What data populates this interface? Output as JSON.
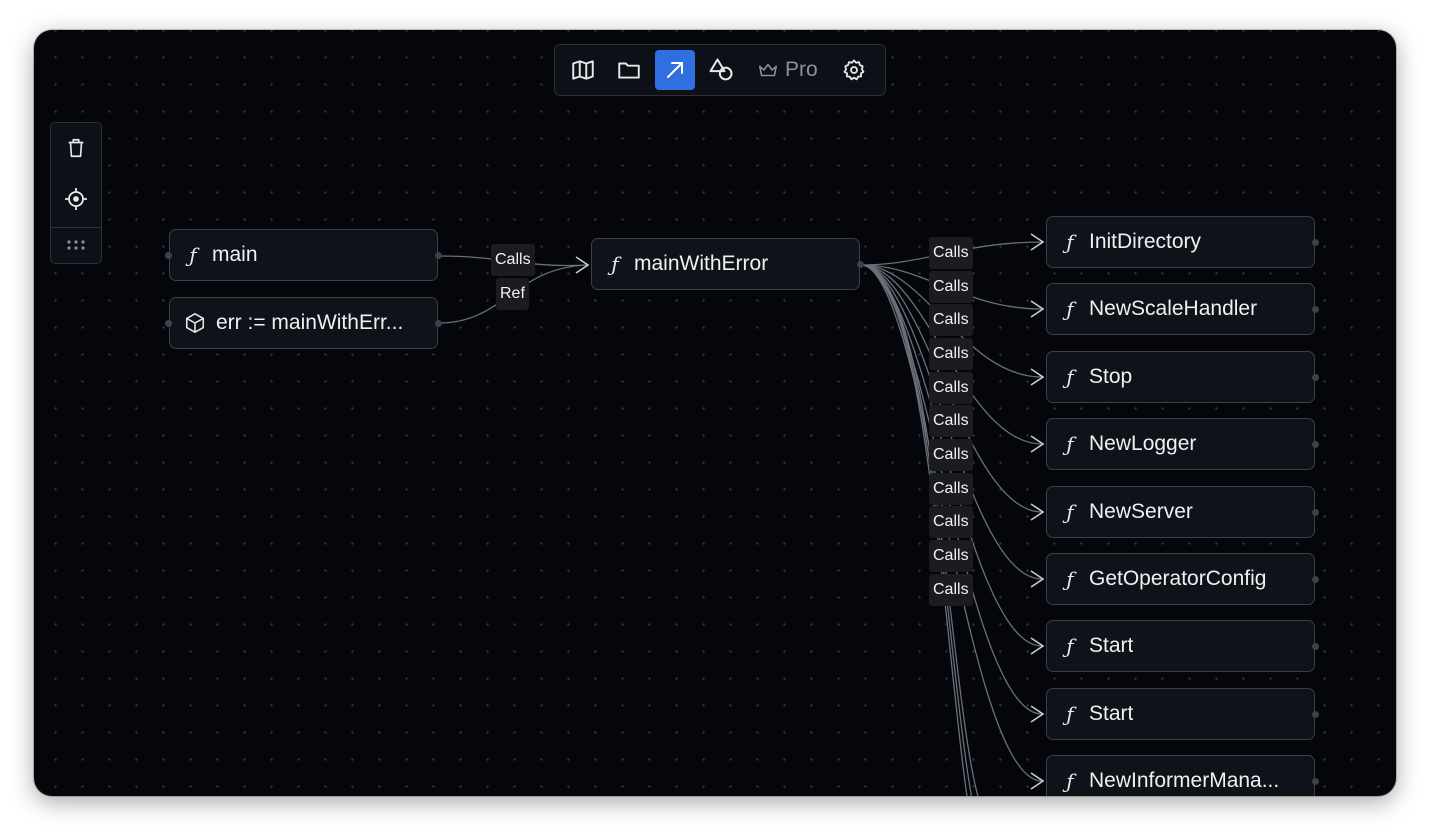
{
  "toolbar": {
    "items": [
      {
        "icon": "map-icon",
        "active": false
      },
      {
        "icon": "folder-icon",
        "active": false
      },
      {
        "icon": "arrow-up-right-icon",
        "active": true
      },
      {
        "icon": "shapes-icon",
        "active": false
      }
    ],
    "pro_label": "Pro",
    "accent": "#2f6fe0"
  },
  "sidepanel": {
    "items": [
      "trash-icon",
      "crosshair-icon",
      "grip-icon"
    ]
  },
  "graph": {
    "sources": [
      {
        "label": "main",
        "kind": "function",
        "icon": "ƒ"
      },
      {
        "label": "err := mainWithErr...",
        "kind": "variable",
        "icon": "cube"
      }
    ],
    "center": {
      "label": "mainWithError",
      "icon": "ƒ"
    },
    "incoming_edges": [
      "Calls",
      "Ref"
    ],
    "targets": [
      {
        "label": "InitDirectory",
        "icon": "ƒ"
      },
      {
        "label": "NewScaleHandler",
        "icon": "ƒ"
      },
      {
        "label": "Stop",
        "icon": "ƒ"
      },
      {
        "label": "NewLogger",
        "icon": "ƒ"
      },
      {
        "label": "NewServer",
        "icon": "ƒ"
      },
      {
        "label": "GetOperatorConfig",
        "icon": "ƒ"
      },
      {
        "label": "Start",
        "icon": "ƒ"
      },
      {
        "label": "Start",
        "icon": "ƒ"
      },
      {
        "label": "NewInformerMana...",
        "icon": "ƒ"
      }
    ],
    "outgoing_edges": [
      "Calls",
      "Calls",
      "Calls",
      "Calls",
      "Calls",
      "Calls",
      "Calls",
      "Calls",
      "Calls",
      "Calls",
      "Calls"
    ]
  }
}
